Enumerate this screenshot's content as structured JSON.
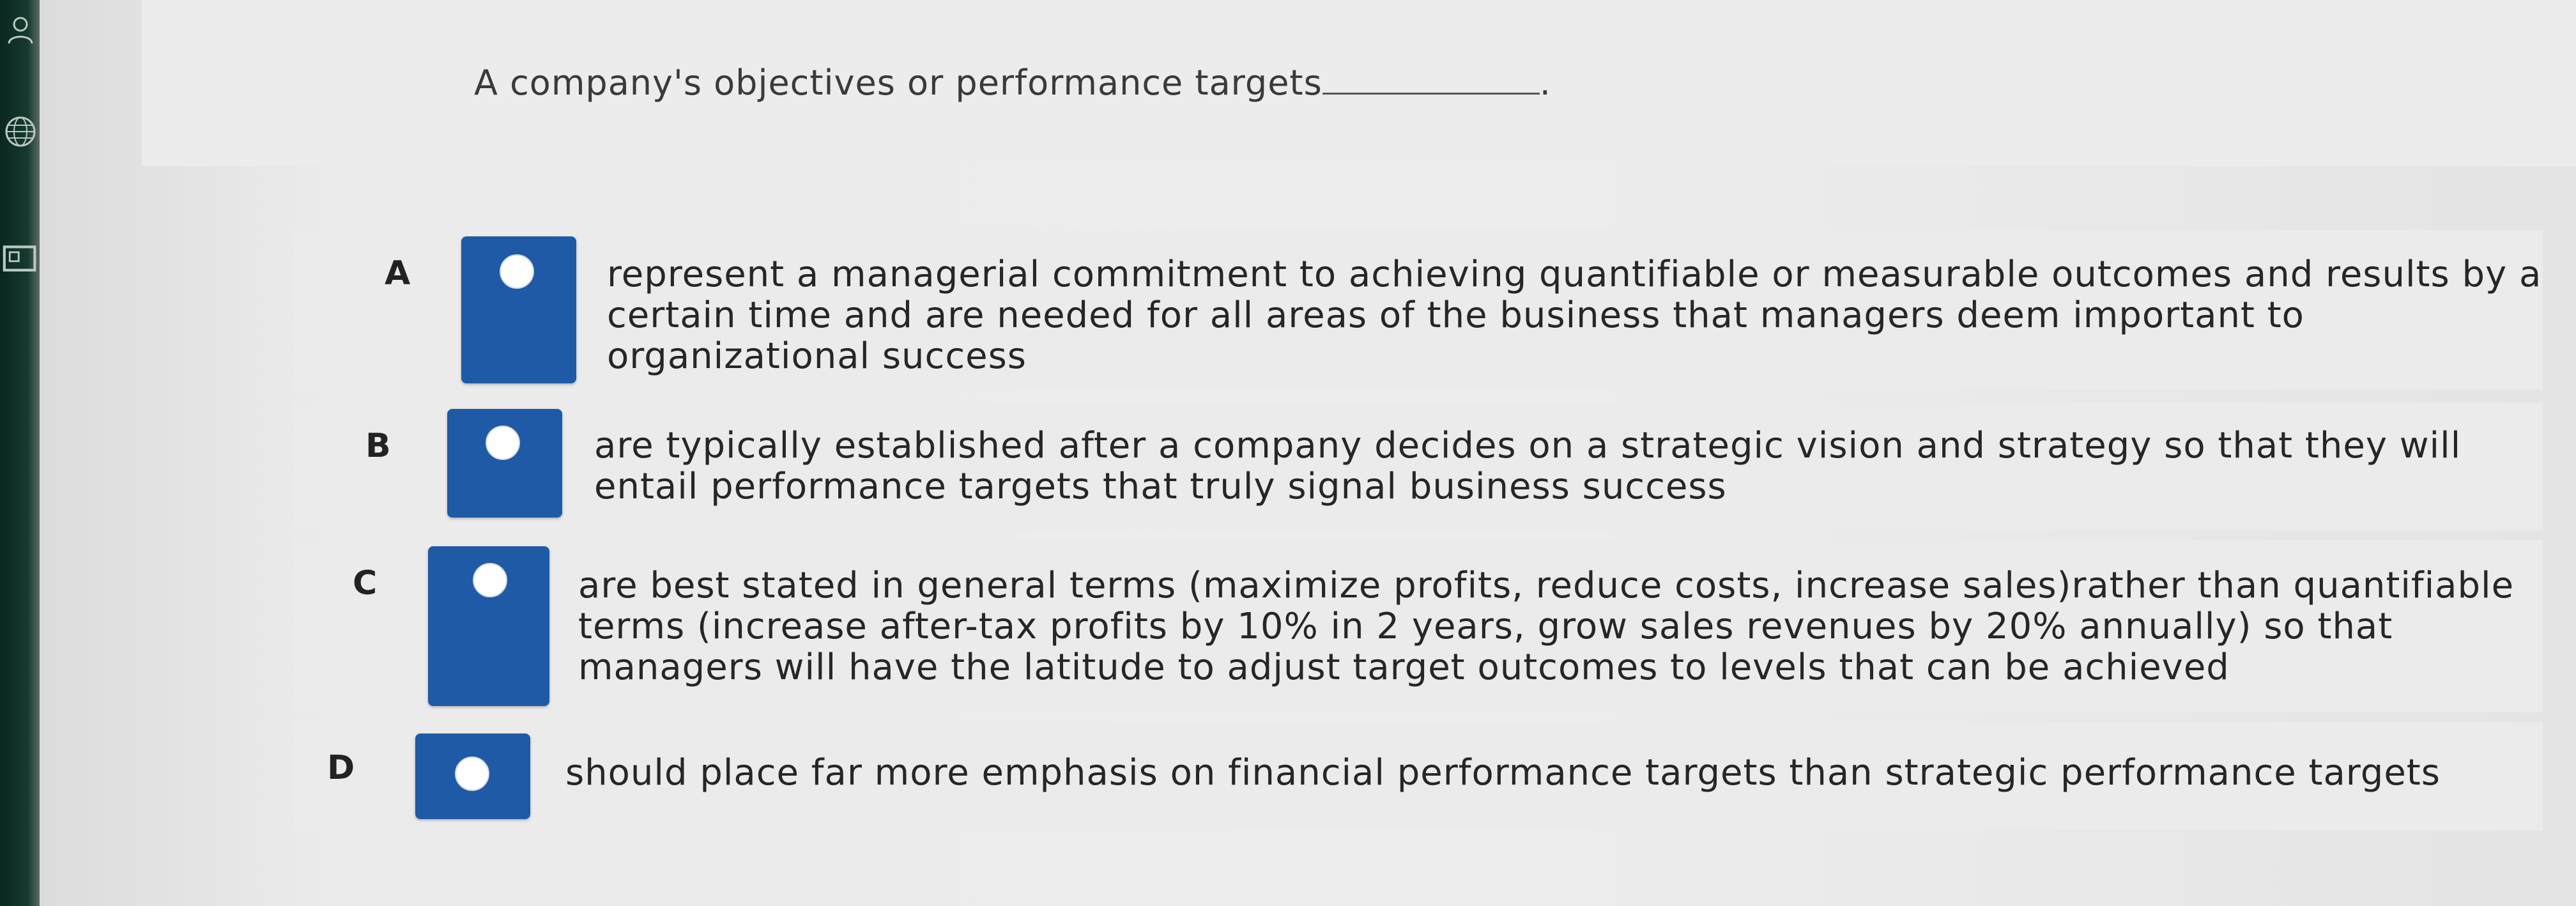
{
  "question": {
    "text": "A company's objectives or performance targets",
    "suffix": "."
  },
  "options": [
    {
      "letter": "A",
      "text": "represent a managerial commitment to achieving quantifiable or measurable outcomes and results by a certain time and are needed for all areas of the business that managers deem important to organizational success",
      "selected": false
    },
    {
      "letter": "B",
      "text": "are typically established after a company decides on a strategic vision and strategy so that they will entail performance targets that truly signal business success",
      "selected": false
    },
    {
      "letter": "C",
      "text": "are best stated in general terms (maximize profits, reduce costs, increase sales)rather than quantifiable terms (increase after-tax profits by 10% in 2 years, grow sales revenues by 20% annually) so that managers will have the latitude to adjust target outcomes to levels that can be achieved",
      "selected": false
    },
    {
      "letter": "D",
      "text": "should place far more emphasis on financial performance targets than strategic performance targets",
      "selected": false
    }
  ],
  "colors": {
    "radio_box": "#1e5aa6",
    "sidebar": "#153a30",
    "background": "#ebebeb"
  },
  "icons": [
    "user-icon",
    "globe-icon",
    "panel-icon"
  ]
}
